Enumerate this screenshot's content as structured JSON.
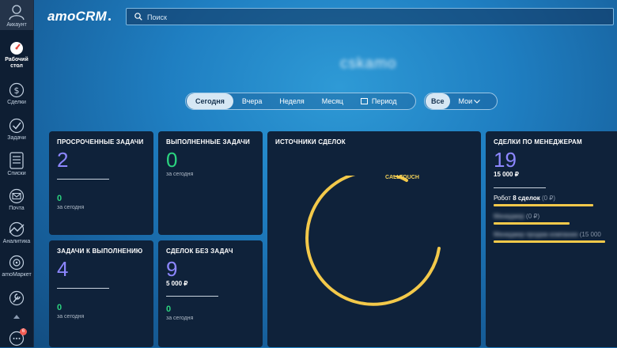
{
  "sidebar": {
    "account": "Аккаунт",
    "items": [
      {
        "label_1": "Рабочий",
        "label_2": "стол"
      },
      {
        "label": "Сделки"
      },
      {
        "label": "Задачи"
      },
      {
        "label": "Списки"
      },
      {
        "label": "Почта"
      },
      {
        "label": "Аналитика"
      },
      {
        "label": "amoМаркет"
      }
    ],
    "chat_badge": "6"
  },
  "header": {
    "logo": "amoCRM",
    "search_placeholder": "Поиск"
  },
  "company_name": "cskamo",
  "period_tabs": [
    "Сегодня",
    "Вчера",
    "Неделя",
    "Месяц",
    "Период"
  ],
  "scope_tabs": [
    "Все",
    "Мои"
  ],
  "widgets": {
    "overdue": {
      "title": "ПРОСРОЧЕННЫЕ ЗАДАЧИ",
      "value": "2",
      "today_value": "0",
      "today_label": "за сегодня"
    },
    "done": {
      "title": "ВЫПОЛНЕННЫЕ ЗАДАЧИ",
      "value": "0",
      "sub": "за сегодня"
    },
    "todo": {
      "title": "ЗАДАЧИ К ВЫПОЛНЕНИЮ",
      "value": "4",
      "today_value": "0",
      "today_label": "за сегодня"
    },
    "no_tasks": {
      "title": "СДЕЛОК БЕЗ ЗАДАЧ",
      "value": "9",
      "money": "5 000 ₽",
      "today_value": "0",
      "today_label": "за сегодня"
    },
    "sources": {
      "title": "ИСТОЧНИКИ СДЕЛОК",
      "segment_label": "CALLTOUCH"
    },
    "managers": {
      "title": "СДЕЛКИ ПО МЕНЕДЖЕРАМ",
      "value": "19",
      "money": "15 000 ₽",
      "rows": [
        {
          "name": "Робот",
          "deals": "8 сделок",
          "amount": "(0 ₽)",
          "bar": 0.84
        },
        {
          "name": "Менеджер",
          "deals": "",
          "amount": "(0 ₽)",
          "bar": 0.64
        },
        {
          "name": "Менеджер продаж компании",
          "deals": "",
          "amount": "(15 000",
          "bar": 0.94
        }
      ]
    }
  },
  "colors": {
    "accent_purple": "#8d87ff",
    "accent_green": "#2bd47f",
    "accent_yellow": "#f3c94a",
    "card_bg": "#0f223a",
    "sidebar_bg": "#0e1e33"
  }
}
